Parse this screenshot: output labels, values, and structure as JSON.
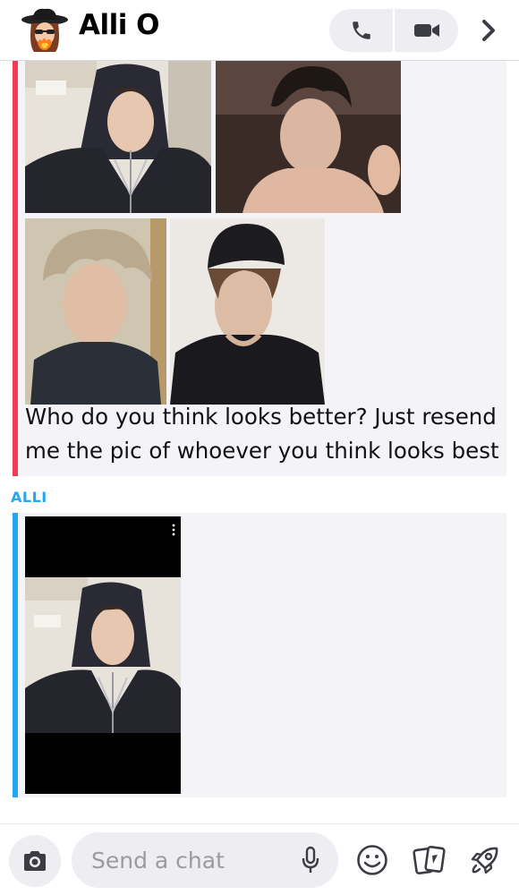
{
  "header": {
    "contact_name": "Alli O",
    "avatar_icon": "bitmoji-avatar-icon",
    "call_icon": "phone-icon",
    "video_icon": "video-camera-icon",
    "more_icon": "chevron-right-icon"
  },
  "messages": [
    {
      "accent_color": "#f23c57",
      "photos": [
        "photo-1",
        "photo-2",
        "photo-3",
        "photo-4"
      ],
      "text": "Who do you think looks better? Just resend me the pic of whoever you think looks best"
    },
    {
      "sender": "ALLI",
      "accent_color": "#22a7f0",
      "attachment": "snap-photo"
    }
  ],
  "composer": {
    "placeholder": "Send a chat",
    "camera_icon": "camera-icon",
    "mic_icon": "microphone-icon",
    "emoji_icon": "smiley-icon",
    "cards_icon": "cards-icon",
    "rocket_icon": "rocket-icon"
  }
}
